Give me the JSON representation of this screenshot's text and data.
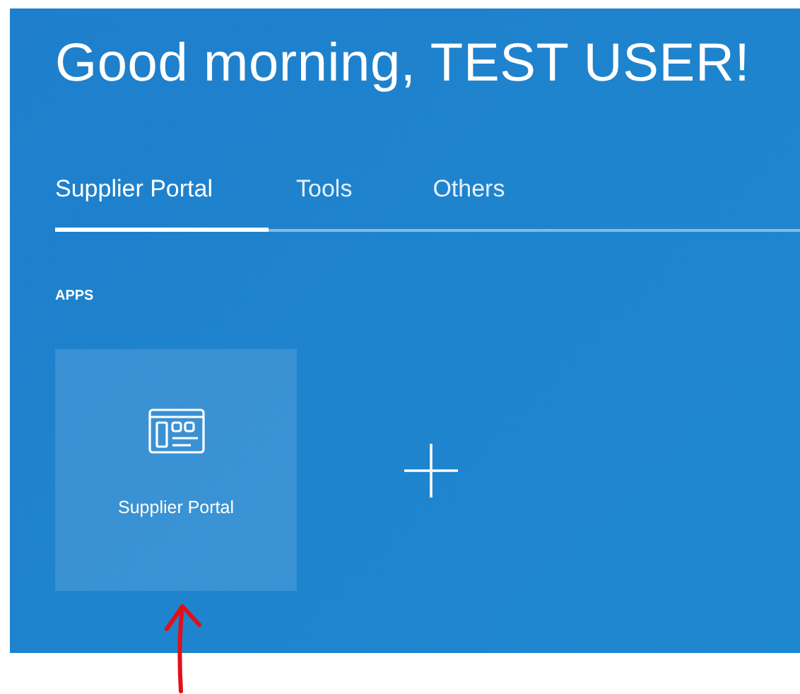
{
  "greeting": "Good morning, TEST USER!",
  "tabs": [
    {
      "label": "Supplier Portal",
      "selected": true
    },
    {
      "label": "Tools",
      "selected": false
    },
    {
      "label": "Others",
      "selected": false
    }
  ],
  "section_label": "APPS",
  "apps": [
    {
      "kind": "app",
      "label": "Supplier Portal"
    },
    {
      "kind": "add"
    }
  ]
}
